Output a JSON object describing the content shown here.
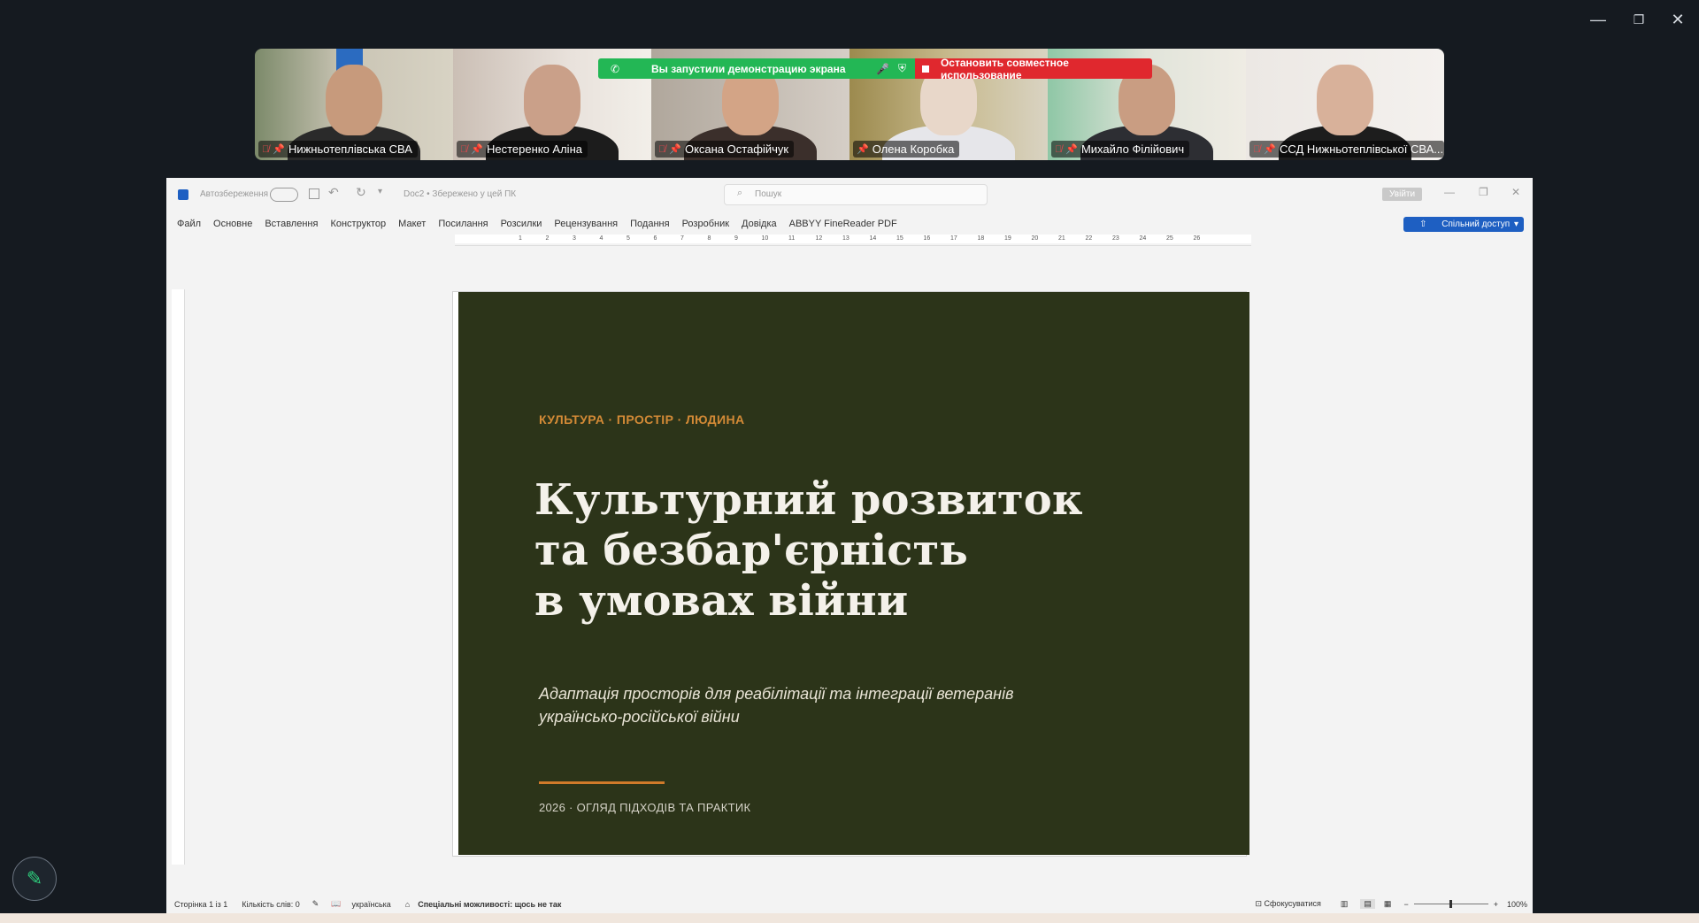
{
  "window_controls": {
    "minimize": "—",
    "restore": "❐",
    "close": "✕"
  },
  "participants": [
    {
      "name": "Нижньотеплівська СВА",
      "mic_muted": true,
      "pinned": true
    },
    {
      "name": "Нестеренко Аліна",
      "mic_muted": true,
      "pinned": true
    },
    {
      "name": "Оксана Остафійчук",
      "mic_muted": true,
      "pinned": true
    },
    {
      "name": "Олена Коробка",
      "mic_muted": false,
      "pinned": true,
      "active": true
    },
    {
      "name": "Михайло Філійович",
      "mic_muted": true,
      "pinned": true
    },
    {
      "name": "ССД Нижньотеплівської СВА...",
      "mic_muted": true,
      "pinned": true
    }
  ],
  "share_banner": {
    "started_text": "Вы запустили демонстрацию экрана",
    "stop_text": "Остановить совместное использование"
  },
  "word": {
    "autosave_label": "Автозбереження",
    "doc_title": "Doc2 • Збережено у цей ПК",
    "search_placeholder": "Пошук",
    "signin_label": "Увійти",
    "share_button": "Спільний доступ",
    "menu": [
      "Файл",
      "Основне",
      "Вставлення",
      "Конструктор",
      "Макет",
      "Посилання",
      "Розсилки",
      "Рецензування",
      "Подання",
      "Розробник",
      "Довідка",
      "ABBYY FineReader PDF"
    ],
    "ruler_numbers": [
      "1",
      "2",
      "3",
      "4",
      "5",
      "6",
      "7",
      "8",
      "9",
      "10",
      "11",
      "12",
      "13",
      "14",
      "15",
      "16",
      "17",
      "18",
      "19",
      "20",
      "21",
      "22",
      "23",
      "24",
      "25",
      "26"
    ],
    "status": {
      "page": "Сторінка 1 із 1",
      "words": "Кількість слів: 0",
      "language": "українська",
      "accessibility": "Спеціальні можливості: щось не так",
      "focus": "Сфокусуватися",
      "zoom": "100%"
    }
  },
  "slide": {
    "kicker": "КУЛЬТУРА · ПРОСТІР · ЛЮДИНА",
    "title_line1": "Культурний розвиток",
    "title_line2": "та безбар'єрність",
    "title_line3": "в умовах війни",
    "subtitle_line1": "Адаптація просторів для реабілітації та інтеграції ветеранів",
    "subtitle_line2": "українсько-російської війни",
    "footer": "2026 · ОГЛЯД ПІДХОДІВ ТА ПРАКТИК"
  },
  "colors": {
    "slide_bg": "#2c3419",
    "accent": "#d07a2a",
    "kicker": "#d38a36",
    "share_green": "#23b755",
    "share_red": "#e0282e",
    "word_blue": "#1e5fc2"
  }
}
